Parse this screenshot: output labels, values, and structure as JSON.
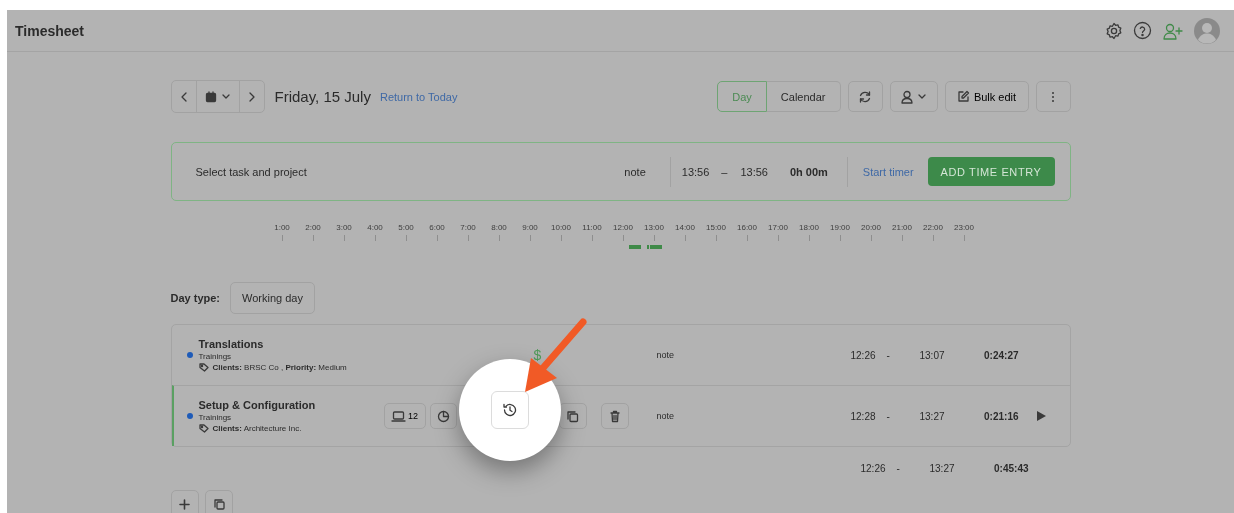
{
  "header": {
    "title": "Timesheet"
  },
  "toolbar": {
    "date": "Friday, 15 July",
    "return_link": "Return to Today",
    "view_tabs": [
      {
        "label": "Day",
        "selected": true
      },
      {
        "label": "Calendar",
        "selected": false
      }
    ],
    "bulk_edit": "Bulk edit"
  },
  "entry_bar": {
    "task_placeholder": "Select task and project",
    "note": "note",
    "start": "13:56",
    "dash": "–",
    "end": "13:56",
    "duration": "0h 00m",
    "start_timer": "Start timer",
    "add_button": "ADD TIME ENTRY"
  },
  "timeline": {
    "hours": [
      "1:00",
      "2:00",
      "3:00",
      "4:00",
      "5:00",
      "6:00",
      "7:00",
      "8:00",
      "9:00",
      "10:00",
      "11:00",
      "12:00",
      "13:00",
      "14:00",
      "15:00",
      "16:00",
      "17:00",
      "18:00",
      "19:00",
      "20:00",
      "21:00",
      "22:00",
      "23:00"
    ]
  },
  "day_type": {
    "label": "Day type:",
    "value": "Working day"
  },
  "entries": [
    {
      "title": "Translations",
      "project": "Trainings",
      "tags": "**Clients:** BRSC Co , **Priority:** Medium",
      "color": "#1e5bb8",
      "billable_mark": "$",
      "hovered": false,
      "running": false,
      "note": "note",
      "start": "12:26",
      "dash": "-",
      "end": "13:07",
      "duration": "0:24:27"
    },
    {
      "title": "Setup & Configuration",
      "project": "Trainings",
      "tags": "**Clients:** Architecture Inc.",
      "color": "#1e5bb8",
      "hovered": true,
      "running": true,
      "screenshots": "12",
      "note": "note",
      "start": "12:28",
      "dash": "-",
      "end": "13:27",
      "duration": "0:21:16"
    }
  ],
  "totals": {
    "start": "12:26",
    "dash": "-",
    "end": "13:27",
    "duration": "0:45:43"
  }
}
